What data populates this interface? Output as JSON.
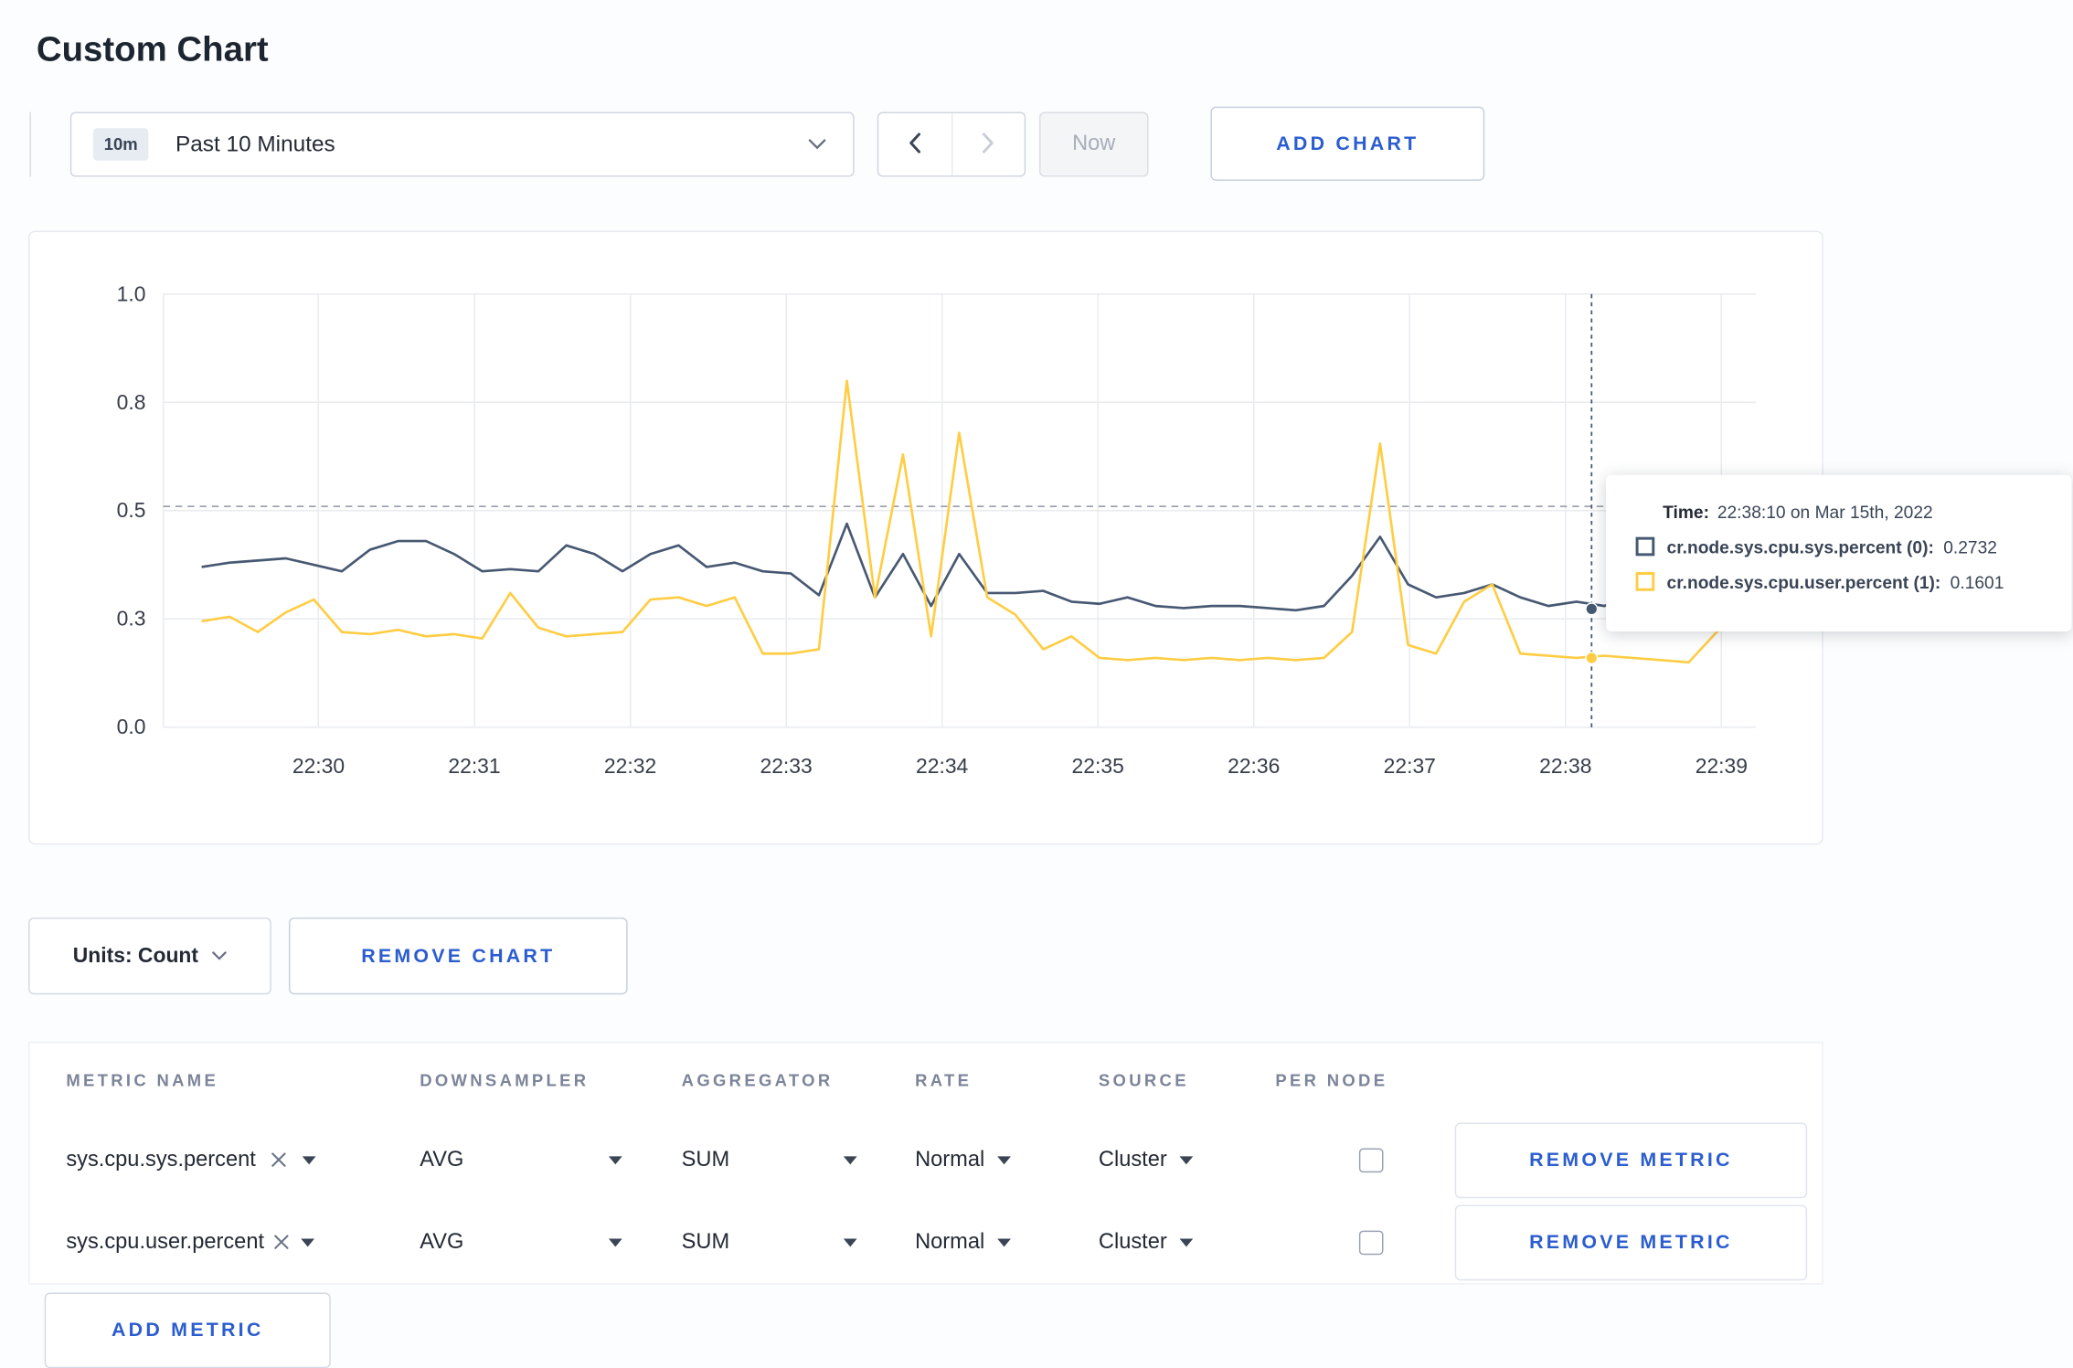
{
  "page": {
    "title": "Custom Chart"
  },
  "colors": {
    "accent_blue": "#2b5dcf",
    "series_sys": "#475872",
    "series_user": "#ffcd44"
  },
  "toolbar": {
    "time_range_badge": "10m",
    "time_range_label": "Past 10 Minutes",
    "now_label": "Now",
    "add_chart_label": "ADD CHART"
  },
  "chart_controls": {
    "units_label": "Units: Count",
    "remove_chart_label": "REMOVE CHART"
  },
  "tooltip": {
    "time_label": "Time:",
    "time_value": "22:38:10 on Mar 15th, 2022",
    "rows": [
      {
        "label": "cr.node.sys.cpu.sys.percent (0):",
        "value": "0.2732",
        "color": "#475872"
      },
      {
        "label": "cr.node.sys.cpu.user.percent (1):",
        "value": "0.1601",
        "color": "#ffcd44"
      }
    ]
  },
  "metrics_table": {
    "headers": [
      "METRIC NAME",
      "DOWNSAMPLER",
      "AGGREGATOR",
      "RATE",
      "SOURCE",
      "PER NODE"
    ],
    "rows": [
      {
        "metric": "sys.cpu.sys.percent",
        "downsampler": "AVG",
        "aggregator": "SUM",
        "rate": "Normal",
        "source": "Cluster",
        "per_node_checked": false,
        "remove_label": "REMOVE METRIC"
      },
      {
        "metric": "sys.cpu.user.percent",
        "downsampler": "AVG",
        "aggregator": "SUM",
        "rate": "Normal",
        "source": "Cluster",
        "per_node_checked": false,
        "remove_label": "REMOVE METRIC"
      }
    ],
    "add_metric_label": "ADD METRIC"
  },
  "chart_data": {
    "type": "line",
    "title": "",
    "x_axis": {
      "tick_labels": [
        "22:30",
        "22:31",
        "22:32",
        "22:33",
        "22:34",
        "22:35",
        "22:36",
        "22:37",
        "22:38",
        "22:39"
      ],
      "tick_positions_min": [
        0,
        1,
        2,
        3,
        4,
        5,
        6,
        7,
        8,
        9
      ]
    },
    "y_axis": {
      "tick_labels": [
        "0.0",
        "0.3",
        "0.5",
        "0.8",
        "1.0"
      ],
      "tick_values": [
        0,
        0.25,
        0.5,
        0.75,
        1.0
      ],
      "range": [
        0,
        1
      ]
    },
    "guideline_y": 0.51,
    "crosshair": {
      "t_min": 8.167,
      "time": "22:38:10 on Mar 15th, 2022"
    },
    "series": [
      {
        "name": "cr.node.sys.cpu.sys.percent",
        "color": "#475872",
        "crosshair_value": 0.2732,
        "x_start_min": -0.75,
        "x_step_min": 0.18,
        "values": [
          0.37,
          0.38,
          0.385,
          0.39,
          0.375,
          0.36,
          0.41,
          0.43,
          0.43,
          0.4,
          0.36,
          0.365,
          0.36,
          0.42,
          0.4,
          0.36,
          0.4,
          0.42,
          0.37,
          0.38,
          0.36,
          0.355,
          0.305,
          0.47,
          0.3,
          0.4,
          0.28,
          0.4,
          0.31,
          0.31,
          0.315,
          0.29,
          0.285,
          0.3,
          0.28,
          0.275,
          0.28,
          0.28,
          0.275,
          0.27,
          0.28,
          0.35,
          0.44,
          0.33,
          0.3,
          0.31,
          0.33,
          0.3,
          0.28,
          0.29,
          0.28,
          0.31,
          0.33,
          0.3,
          0.3,
          0.31
        ]
      },
      {
        "name": "cr.node.sys.cpu.user.percent",
        "color": "#ffcd44",
        "crosshair_value": 0.1601,
        "x_start_min": -0.75,
        "x_step_min": 0.18,
        "values": [
          0.245,
          0.255,
          0.22,
          0.265,
          0.295,
          0.22,
          0.215,
          0.225,
          0.21,
          0.215,
          0.205,
          0.31,
          0.23,
          0.21,
          0.215,
          0.22,
          0.295,
          0.3,
          0.28,
          0.3,
          0.17,
          0.17,
          0.18,
          0.8,
          0.3,
          0.63,
          0.21,
          0.68,
          0.3,
          0.26,
          0.18,
          0.21,
          0.16,
          0.155,
          0.16,
          0.155,
          0.16,
          0.155,
          0.16,
          0.155,
          0.16,
          0.22,
          0.655,
          0.19,
          0.17,
          0.29,
          0.33,
          0.17,
          0.165,
          0.16,
          0.165,
          0.16,
          0.155,
          0.15,
          0.22,
          0.27
        ]
      }
    ]
  }
}
